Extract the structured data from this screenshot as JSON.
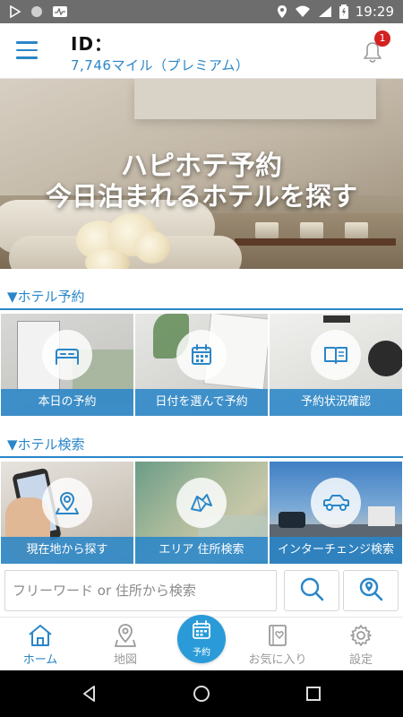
{
  "status_bar": {
    "time": "19:29"
  },
  "header": {
    "id_label": "ID：",
    "miles": "7,746マイル（プレミアム）",
    "notification_count": "1"
  },
  "hero": {
    "title_line1": "ハピホテ予約",
    "title_line2": "今日泊まれるホテルを探す"
  },
  "hotel_reservation": {
    "title": "▼ホテル予約",
    "tiles": [
      {
        "label": "本日の予約",
        "icon": "bed-icon"
      },
      {
        "label": "日付を選んで予約",
        "icon": "calendar-icon"
      },
      {
        "label": "予約状況確認",
        "icon": "book-icon"
      }
    ]
  },
  "hotel_search": {
    "title": "▼ホテル検索",
    "tiles": [
      {
        "label": "現在地から探す",
        "icon": "location-map-icon"
      },
      {
        "label": "エリア 住所検索",
        "icon": "map-icon"
      },
      {
        "label": "インターチェンジ検索",
        "icon": "car-icon"
      }
    ]
  },
  "search": {
    "placeholder": "フリーワード or 住所から検索"
  },
  "bottom_nav": {
    "home": "ホーム",
    "map": "地図",
    "reserve": "予約",
    "favorites": "お気に入り",
    "settings": "設定"
  },
  "colors": {
    "accent": "#2a86c8",
    "badge": "#d32222",
    "status_bar": "#6d6d6d"
  }
}
